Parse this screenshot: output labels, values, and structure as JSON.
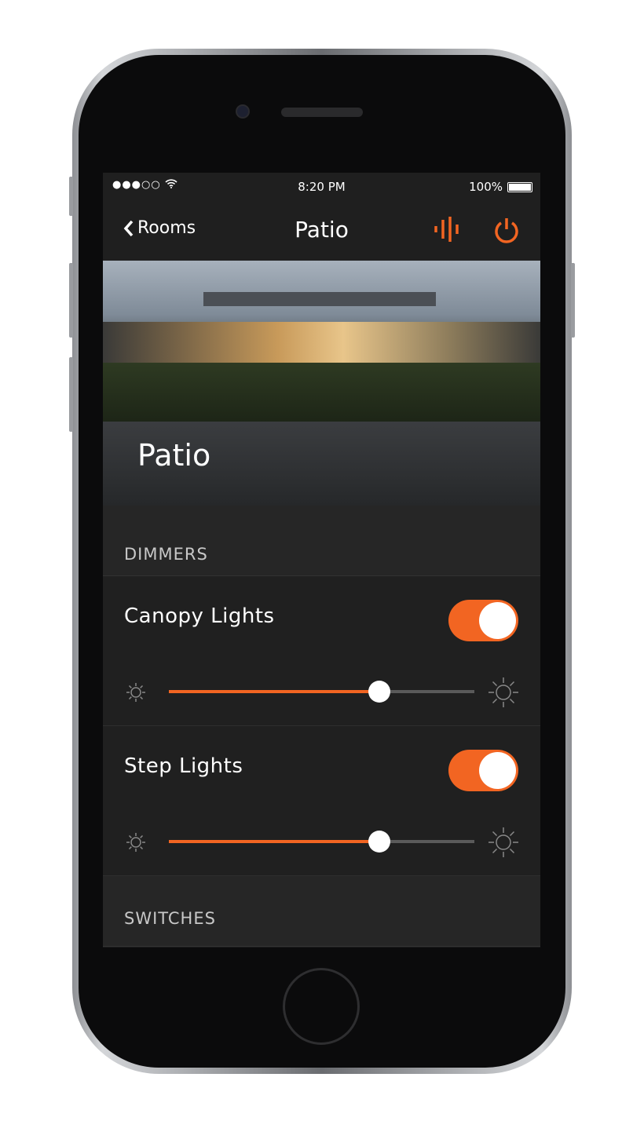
{
  "status_bar": {
    "signal": "●●●○○",
    "time": "8:20 PM",
    "battery": "100%"
  },
  "nav": {
    "back_label": "Rooms",
    "title": "Patio"
  },
  "hero": {
    "room_name": "Patio"
  },
  "sections": {
    "dimmers": "DIMMERS",
    "switches": "SWITCHES"
  },
  "dimmers": [
    {
      "label": "Canopy Lights",
      "on": true,
      "level": 0.69
    },
    {
      "label": "Step Lights",
      "on": true,
      "level": 0.69
    }
  ],
  "colors": {
    "accent": "#f26522",
    "background": "#1f1f1f"
  }
}
